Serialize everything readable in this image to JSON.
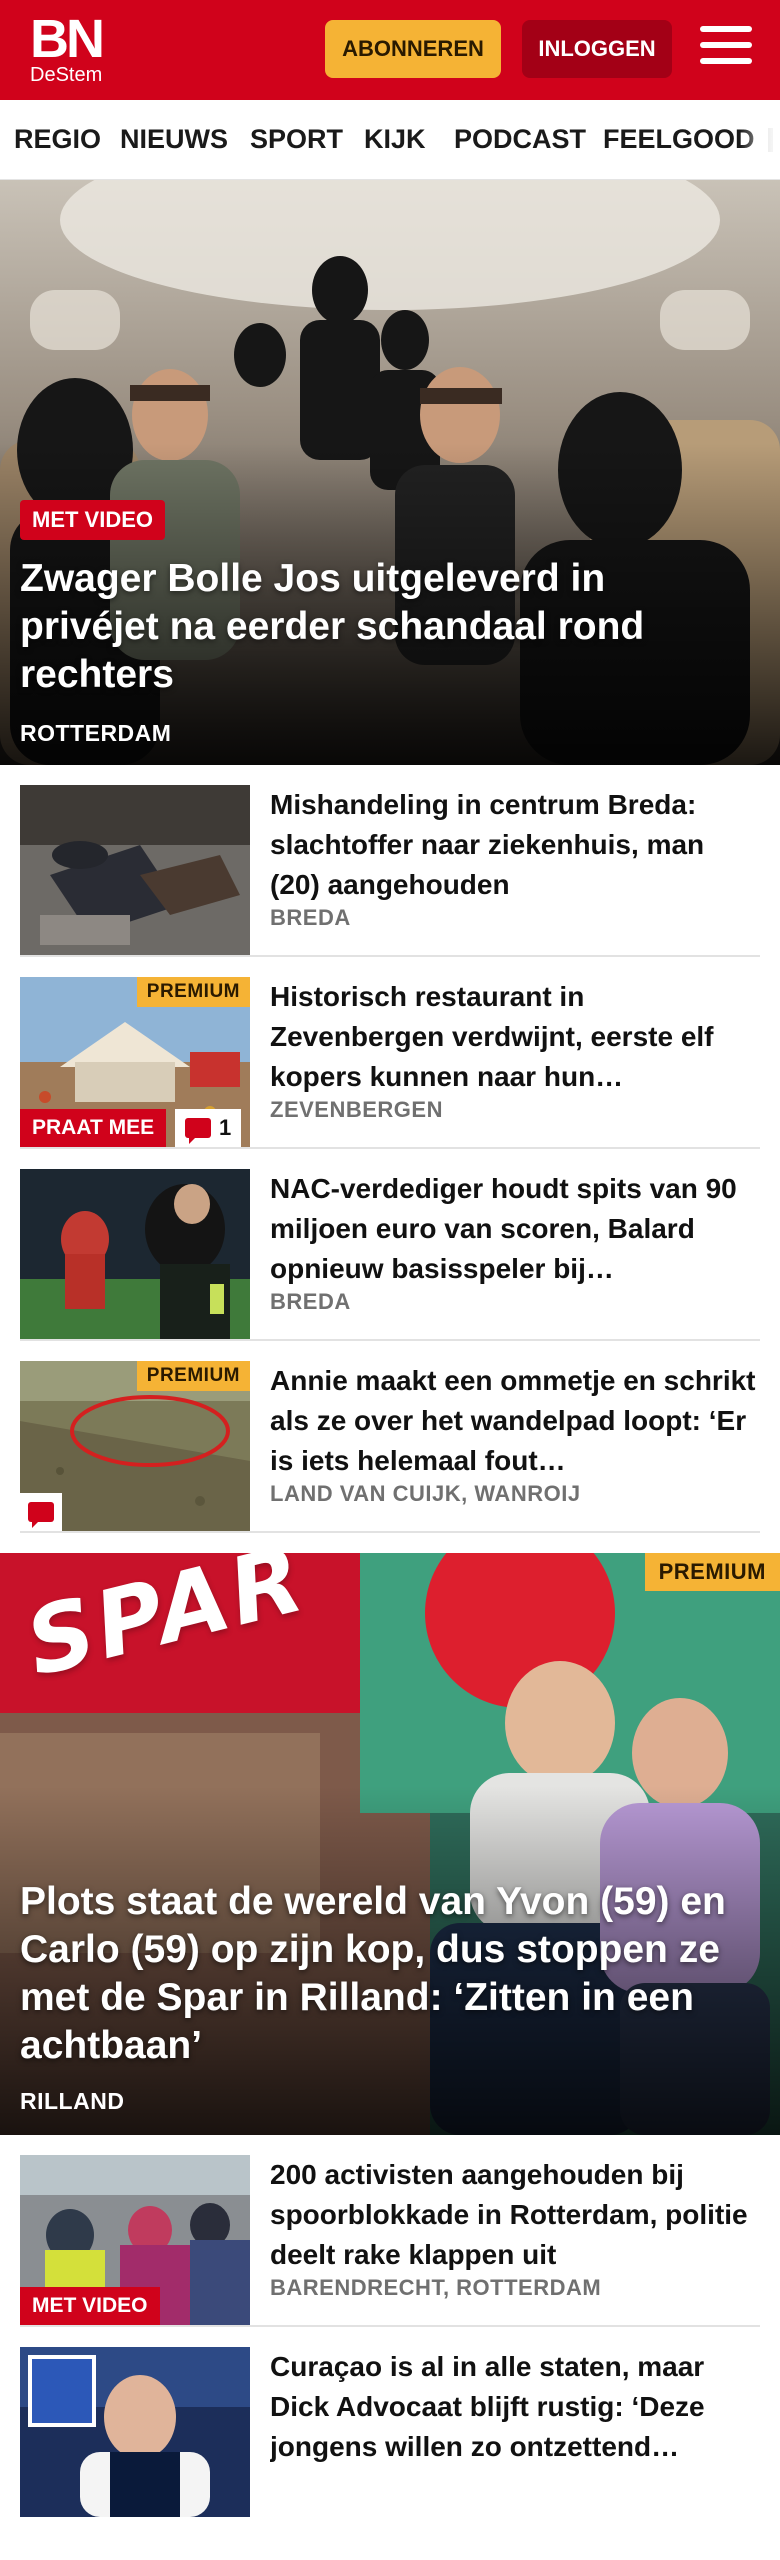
{
  "header": {
    "logo_main": "BN",
    "logo_sub": "DeStem",
    "subscribe_label": "ABONNEREN",
    "login_label": "INLOGGEN",
    "brand_color": "#d0021b",
    "accent_color": "#f5b335"
  },
  "nav": {
    "items": [
      "REGIO",
      "NIEUWS",
      "SPORT",
      "KIJK",
      "PODCAST",
      "FEELGOOD"
    ]
  },
  "hero": {
    "tag": "MET VIDEO",
    "title": "Zwager Bolle Jos uitgeleverd in privéjet na eerder schandaal rond rechters",
    "location": "ROTTERDAM"
  },
  "articles": [
    {
      "title": "Mishandeling in centrum Breda: slachtoffer naar ziekenhuis, man (20) aangehouden",
      "location": "BREDA"
    },
    {
      "title": "Historisch restaurant in Zevenbergen verdwijnt, eerste elf kopers kunnen naar hun…",
      "location": "ZEVENBERGEN",
      "premium": "PREMIUM",
      "tag": "PRAAT MEE",
      "comments": "1"
    },
    {
      "title": "NAC-verdediger houdt spits van 90 miljoen euro van scoren, Balard opnieuw basisspeler bij…",
      "location": "BREDA"
    },
    {
      "title": "Annie maakt een ommetje en schrikt als ze over het wandelpad loopt: ‘Er is iets helemaal fout…",
      "location": "LAND VAN CUIJK, WANROIJ",
      "premium": "PREMIUM"
    }
  ],
  "feature": {
    "premium": "PREMIUM",
    "sign_text": "SPAR",
    "title": "Plots staat de wereld van Yvon (59) en Carlo (59) op zijn kop, dus stoppen ze met de Spar in Rilland: ‘Zitten in een achtbaan’",
    "location": "RILLAND"
  },
  "articles2": [
    {
      "title": "200 activisten aangehouden bij spoorblokkade in Rotterdam, politie deelt rake klappen uit",
      "location": "BARENDRECHT, ROTTERDAM",
      "tag": "MET VIDEO"
    },
    {
      "title": "Curaçao is al in alle staten, maar Dick Advocaat blijft rustig: ‘Deze jongens willen zo ontzettend…",
      "location": ""
    }
  ]
}
